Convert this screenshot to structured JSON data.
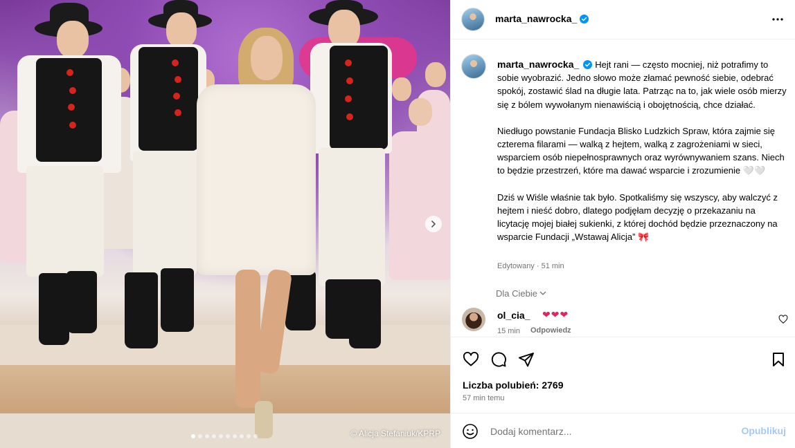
{
  "post": {
    "author": "marta_nawrocka_",
    "photo_credit": "© Alicja Stefaniuk/KPRP",
    "carousel": {
      "total_slides": 10,
      "active_slide": 1
    }
  },
  "caption": {
    "username": "marta_nawrocka_",
    "paragraph_1": "Hejt rani — często mocniej, niż potrafimy to sobie wyobrazić. Jedno słowo może złamać pewność siebie, odebrać spokój, zostawić ślad na długie lata. Patrząc na to, jak wiele osób mierzy się z bólem wywołanym nienawiścią i obojętnością, chce działać.",
    "paragraph_2": "Niedługo powstanie Fundacja Blisko Ludzkich Spraw, która zajmie się czterema filarami — walką z hejtem, walką z zagrożeniami w sieci, wsparciem osób niepełnosprawnych oraz wyrównywaniem szans. Niech to będzie przestrzeń, które ma dawać wsparcie i zrozumienie 🤍🤍",
    "paragraph_3": "Dziś w Wiśle właśnie tak było. Spotkaliśmy się wszyscy, aby walczyć z hejtem i nieść dobro, dlatego podjęłam decyzję o przekazaniu na licytację mojej białej sukienki, z której dochód będzie przeznaczony na wsparcie Fundacji „Wstawaj Alicja” 🎀",
    "edited": "Edytowany · 51 min"
  },
  "for_you_label": "Dla Ciebie",
  "comment": {
    "username": "ol_cia_",
    "text": "❤❤❤",
    "time": "15 min",
    "reply_label": "Odpowiedz"
  },
  "likes_text": "Liczba polubień: 2769",
  "posted_time": "57 min temu",
  "add_comment": {
    "placeholder": "Dodaj komentarz...",
    "publish_label": "Opublikuj"
  },
  "icons": {
    "verified": "verified-badge-icon",
    "more": "more-options-icon",
    "like": "heart-icon",
    "comment": "comment-bubble-icon",
    "share": "paper-plane-icon",
    "save": "bookmark-icon",
    "emoji": "emoji-icon",
    "next": "chevron-right-icon"
  },
  "colors": {
    "verified_blue": "#0095f6",
    "heart_red": "#e0245e",
    "publish_disabled": "#a5c9f5",
    "secondary_text": "#737373"
  }
}
